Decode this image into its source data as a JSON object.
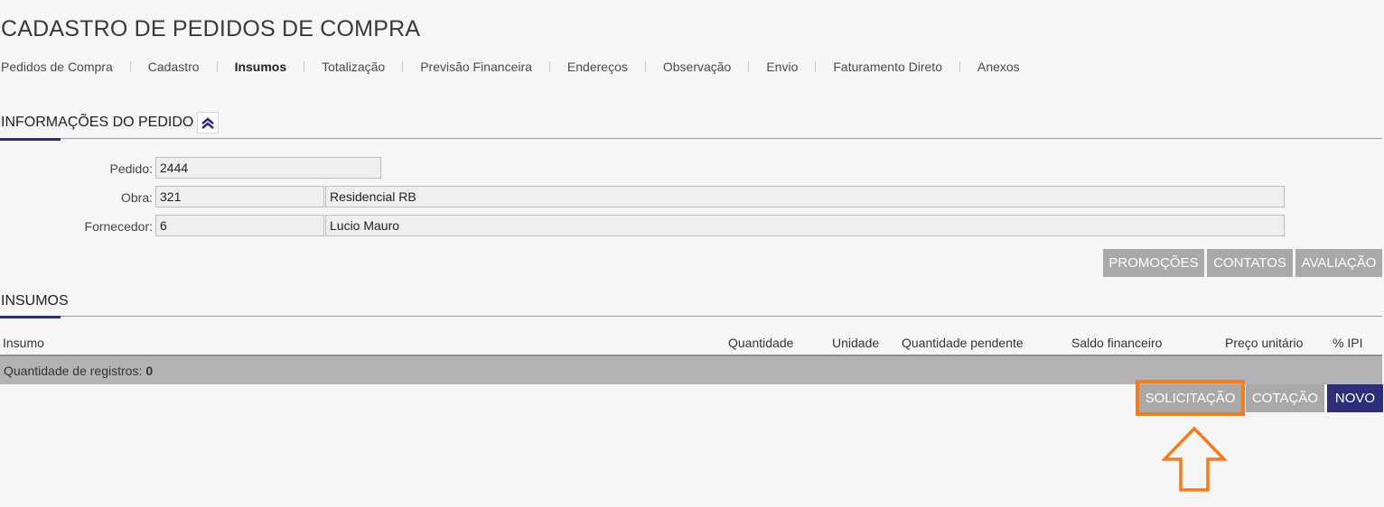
{
  "page": {
    "title": "CADASTRO DE PEDIDOS DE COMPRA"
  },
  "tabs": [
    {
      "label": "Pedidos de Compra"
    },
    {
      "label": "Cadastro"
    },
    {
      "label": "Insumos",
      "active": true
    },
    {
      "label": "Totalização"
    },
    {
      "label": "Previsão Financeira"
    },
    {
      "label": "Endereços"
    },
    {
      "label": "Observação"
    },
    {
      "label": "Envio"
    },
    {
      "label": "Faturamento Direto"
    },
    {
      "label": "Anexos"
    }
  ],
  "order_info": {
    "title": "INFORMAÇÕES DO PEDIDO",
    "collapse_icon": "double-chevron-up-icon",
    "fields": {
      "pedido": {
        "label": "Pedido:",
        "value": "2444"
      },
      "obra": {
        "label": "Obra:",
        "code": "321",
        "name": "Residencial RB"
      },
      "fornecedor": {
        "label": "Fornecedor:",
        "code": "6",
        "name": "Lucio Mauro"
      }
    },
    "buttons": {
      "promocoes": "PROMOÇÕES",
      "contatos": "CONTATOS",
      "avaliacao": "AVALIAÇÃO"
    }
  },
  "insumos": {
    "title": "INSUMOS",
    "columns": [
      "Insumo",
      "Quantidade",
      "Unidade",
      "Quantidade pendente",
      "Saldo financeiro",
      "Preço unitário",
      "% IPI"
    ],
    "rows": [],
    "footer": {
      "label": "Quantidade de registros:",
      "count": "0"
    },
    "buttons": {
      "solicitacao": "SOLICITAÇÃO",
      "cotacao": "COTAÇÃO",
      "novo": "NOVO"
    }
  },
  "colors": {
    "primary": "#2b2f7a",
    "button_gray": "#a9a9a9",
    "highlight": "#f47b20",
    "background": "#f6f6f6"
  },
  "annotation": {
    "icon": "up-arrow-outline-icon"
  }
}
